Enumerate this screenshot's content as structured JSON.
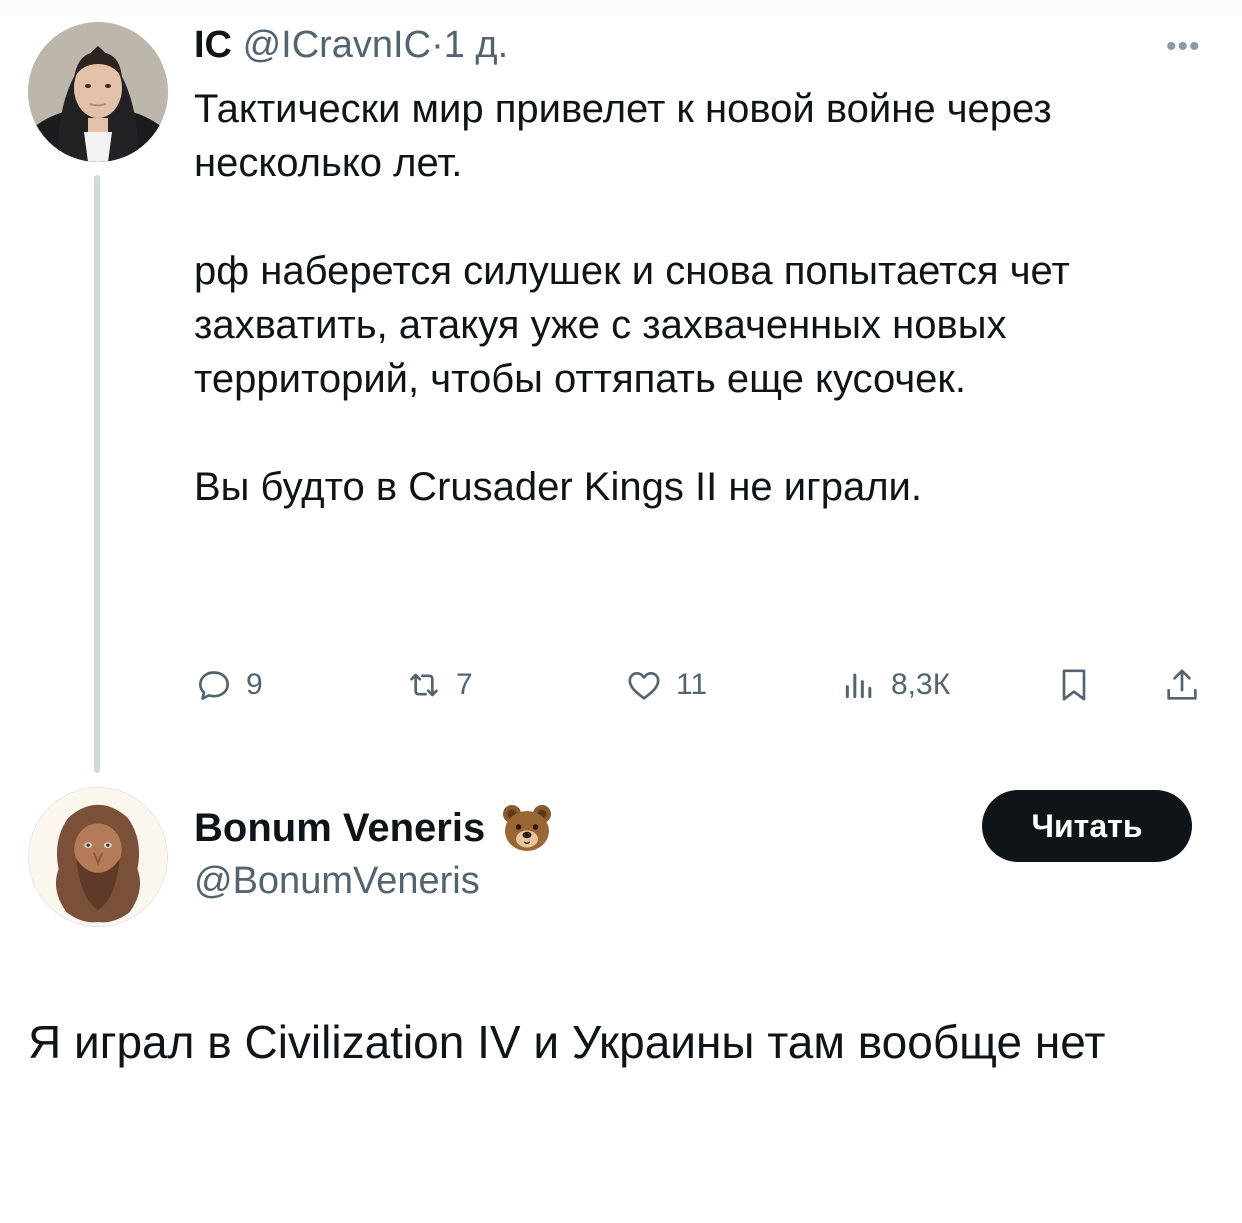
{
  "original_tweet": {
    "display_name": "IC",
    "handle": "@ICravnIC",
    "separator": "·",
    "time": "1 д.",
    "more_label": "•••",
    "paragraphs": [
      "Тактически мир привелет к новой войне через несколько лет.",
      "рф наберется силушек и снова попытается чет захватить, атакуя уже с захваченных новых территорий, чтобы оттяпать еще кусочек.",
      "Вы будто в Crusader Kings II не играли."
    ],
    "actions": {
      "replies": "9",
      "retweets": "7",
      "likes": "11",
      "views": "8,3К"
    },
    "action_icons": [
      "reply-icon",
      "retweet-icon",
      "like-icon",
      "views-icon",
      "bookmark-icon",
      "share-icon"
    ]
  },
  "reply_tweet": {
    "display_name": "Bonum Veneris",
    "emoji": "bear-emoji",
    "handle": "@BonumVeneris",
    "follow_label": "Читать",
    "text": "Я играл в Civilization IV и Украины там вообще нет"
  },
  "colors": {
    "text_primary": "#0f1419",
    "text_secondary": "#536471",
    "thread_line": "#cfd9de",
    "button_bg": "#0f1419",
    "button_text": "#ffffff"
  }
}
